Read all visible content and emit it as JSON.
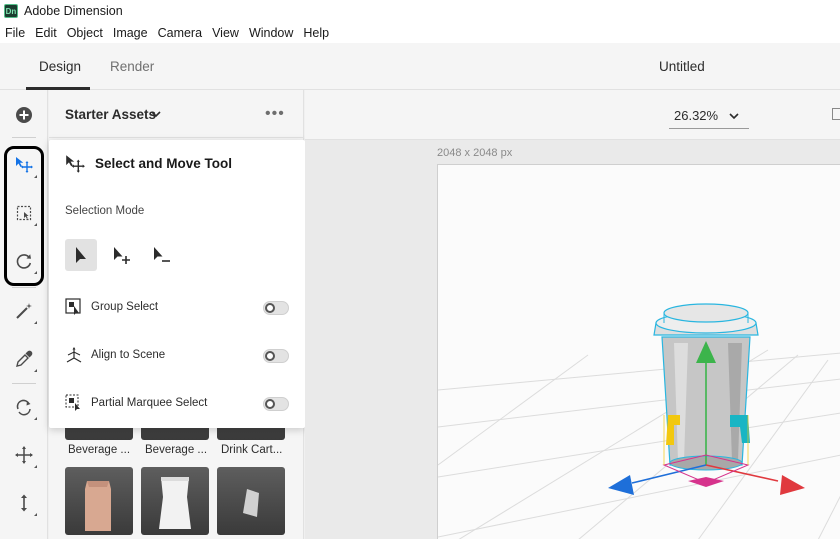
{
  "window": {
    "title": "Adobe Dimension",
    "logo_text": "Dn"
  },
  "menubar": {
    "items": [
      "File",
      "Edit",
      "Object",
      "Image",
      "Camera",
      "View",
      "Window",
      "Help"
    ]
  },
  "header": {
    "tabs": [
      {
        "label": "Design",
        "active": true
      },
      {
        "label": "Render",
        "active": false
      }
    ],
    "document_title": "Untitled"
  },
  "toolrail": {
    "tools": [
      {
        "name": "add-icon"
      },
      {
        "name": "select-move-icon"
      },
      {
        "name": "marquee-select-icon"
      },
      {
        "name": "orbit-icon"
      },
      {
        "name": "magic-wand-icon"
      },
      {
        "name": "eyedropper-icon"
      },
      {
        "name": "pan-icon"
      },
      {
        "name": "move-icon"
      },
      {
        "name": "dolly-icon"
      }
    ],
    "accent": "#1473e6"
  },
  "assets": {
    "title": "Starter Assets",
    "more": "•••",
    "row1_labels": [
      "Beverage ...",
      "Beverage ...",
      "Drink Cart..."
    ]
  },
  "popover": {
    "title": "Select and Move Tool",
    "selection_mode_label": "Selection Mode",
    "options": [
      {
        "label": "Group Select",
        "on": false
      },
      {
        "label": "Align to Scene",
        "on": false
      },
      {
        "label": "Partial Marquee Select",
        "on": false
      }
    ]
  },
  "canvas": {
    "zoom": "26.32%",
    "size_label": "2048 x 2048 px",
    "gizmo_colors": {
      "y": "#3cb44b",
      "x": "#e0393e",
      "z": "#1e6fd9",
      "yellow": "#f2c80f",
      "cyan": "#19b5c4",
      "magenta": "#d6338c"
    }
  }
}
